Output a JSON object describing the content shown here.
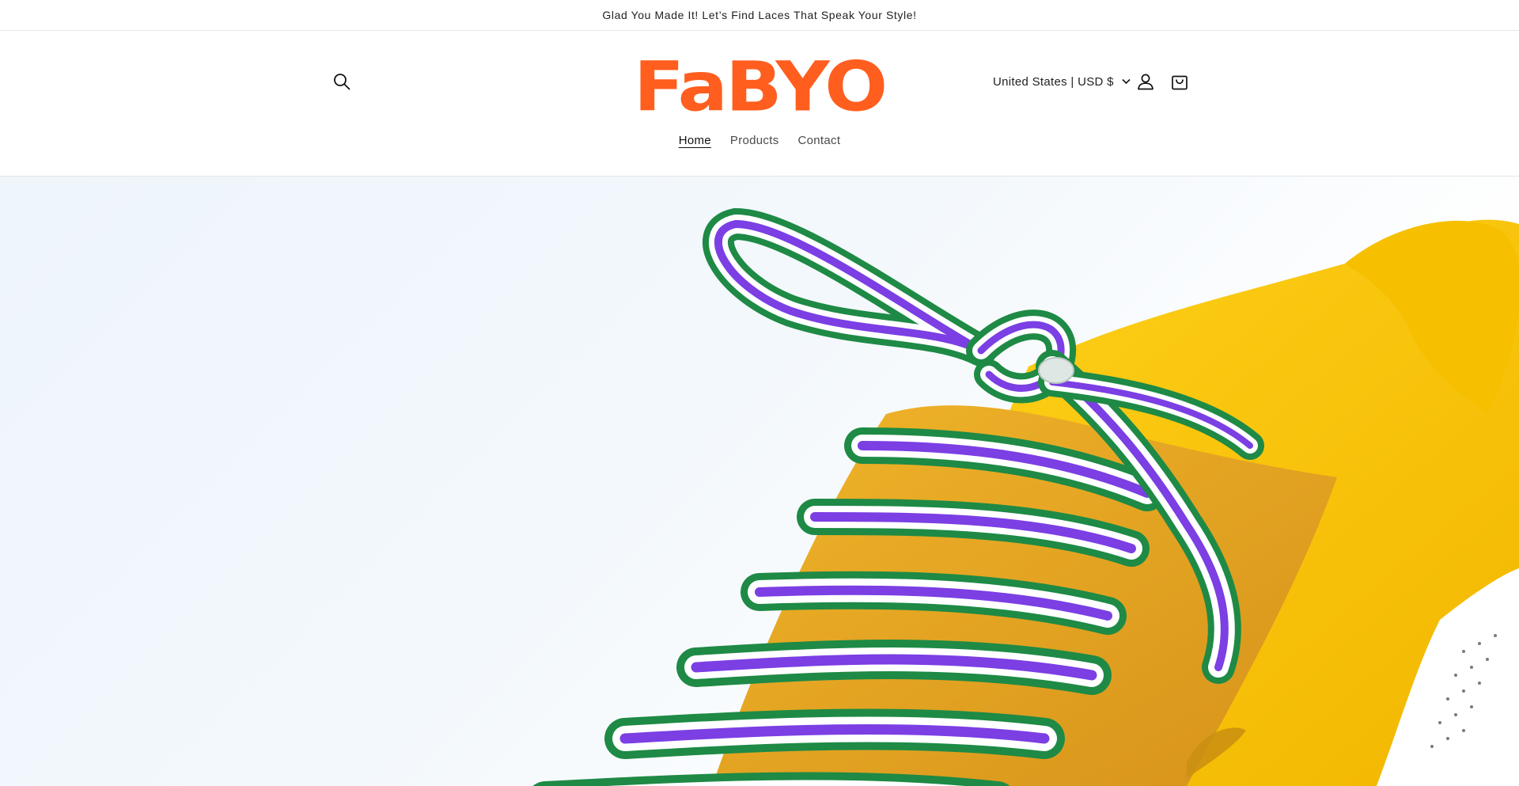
{
  "announcement": {
    "text": "Glad You Made It! Let’s Find Laces That Speak Your Style!"
  },
  "header": {
    "logo_text": "FaBYO",
    "logo_color": "#ff5e1f",
    "search_icon": "search-icon",
    "account_icon": "user-icon",
    "cart_icon": "bag-icon",
    "currency_label": "United States | USD $",
    "currency_chevron": "chevron-down-icon"
  },
  "nav": {
    "items": [
      {
        "label": "Home",
        "active": true
      },
      {
        "label": "Products",
        "active": false
      },
      {
        "label": "Contact",
        "active": false
      }
    ]
  },
  "hero": {
    "image": "hero-shoe-laces-image",
    "colors": {
      "sky": "#eef5fb",
      "lace_green": "#1e8a45",
      "lace_purple": "#7b3fe4",
      "lace_white": "#ffffff",
      "shoe_yellow": "#f7c400",
      "suede_orange": "#e0a21a"
    }
  }
}
